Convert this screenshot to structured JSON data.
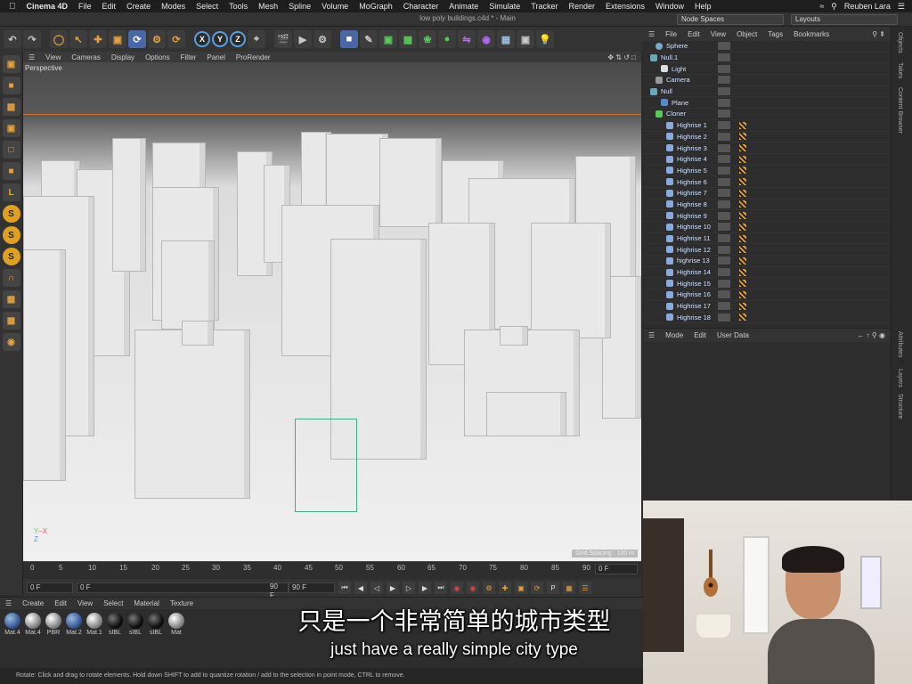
{
  "menubar": {
    "app": "Cinema 4D",
    "items": [
      "File",
      "Edit",
      "Create",
      "Modes",
      "Select",
      "Tools",
      "Mesh",
      "Spline",
      "Volume",
      "MoGraph",
      "Character",
      "Animate",
      "Simulate",
      "Tracker",
      "Render",
      "Extensions",
      "Window",
      "Help"
    ],
    "user": "Reuben Lara"
  },
  "window": {
    "title": "low poly buildings.c4d * - Main",
    "node_spaces": "Node Spaces",
    "layouts": "Layouts"
  },
  "toolbar": {
    "axis_x": "X",
    "axis_y": "Y",
    "axis_z": "Z"
  },
  "viewport": {
    "menu": [
      "View",
      "Cameras",
      "Display",
      "Options",
      "Filter",
      "Panel",
      "ProRender"
    ],
    "label": "Perspective",
    "scale_text": "Grid Spacing : 100 m"
  },
  "timeline": {
    "ticks": [
      "0",
      "5",
      "10",
      "15",
      "20",
      "25",
      "30",
      "35",
      "40",
      "45",
      "50",
      "55",
      "60",
      "65",
      "70",
      "75",
      "80",
      "85",
      "90"
    ],
    "frame_end_label": "0 F",
    "start": "0 F",
    "current": "0 F",
    "end_a": "90 F",
    "end_b": "90 F"
  },
  "materials": {
    "menu": [
      "Create",
      "Edit",
      "View",
      "Select",
      "Material",
      "Texture"
    ],
    "items": [
      {
        "label": "Mat.4",
        "style": "bl"
      },
      {
        "label": "Mat.4",
        "style": ""
      },
      {
        "label": "PBR",
        "style": ""
      },
      {
        "label": "Mat.2",
        "style": "bl"
      },
      {
        "label": "Mat.1",
        "style": ""
      },
      {
        "label": "sIBL",
        "style": "dk"
      },
      {
        "label": "sIBL",
        "style": "dk"
      },
      {
        "label": "sIBL",
        "style": "dk"
      },
      {
        "label": "Mat",
        "style": ""
      }
    ]
  },
  "status": "Rotate: Click and drag to rotate elements. Hold down SHIFT to add to quantize rotation / add to the selection in point mode, CTRL to remove.",
  "objects": {
    "menu": [
      "File",
      "Edit",
      "View",
      "Object",
      "Tags",
      "Bookmarks"
    ],
    "items": [
      "Sphere",
      "Null.1",
      "Light",
      "Camera",
      "Null",
      "Plane",
      "Cloner",
      "Highrise 1",
      "Highrise 2",
      "Highrise 3",
      "Highrise 4",
      "Highrise 5",
      "Highrise 6",
      "Highrise 7",
      "Highrise 8",
      "Highrise 9",
      "Highrise 10",
      "Highrise 11",
      "Highrise 12",
      "highrise 13",
      "Highrise 14",
      "Highrise 15",
      "Highrise 16",
      "Highrise 17",
      "Highrise 18"
    ]
  },
  "attributes": {
    "menu": [
      "Mode",
      "Edit",
      "User Data"
    ]
  },
  "sidetabs": [
    "Objects",
    "Takes",
    "Content Browser",
    "Attributes",
    "Layers",
    "Structure"
  ],
  "subtitle": {
    "cn": "只是一个非常简单的城市类型",
    "en": "just have a really simple city type"
  }
}
